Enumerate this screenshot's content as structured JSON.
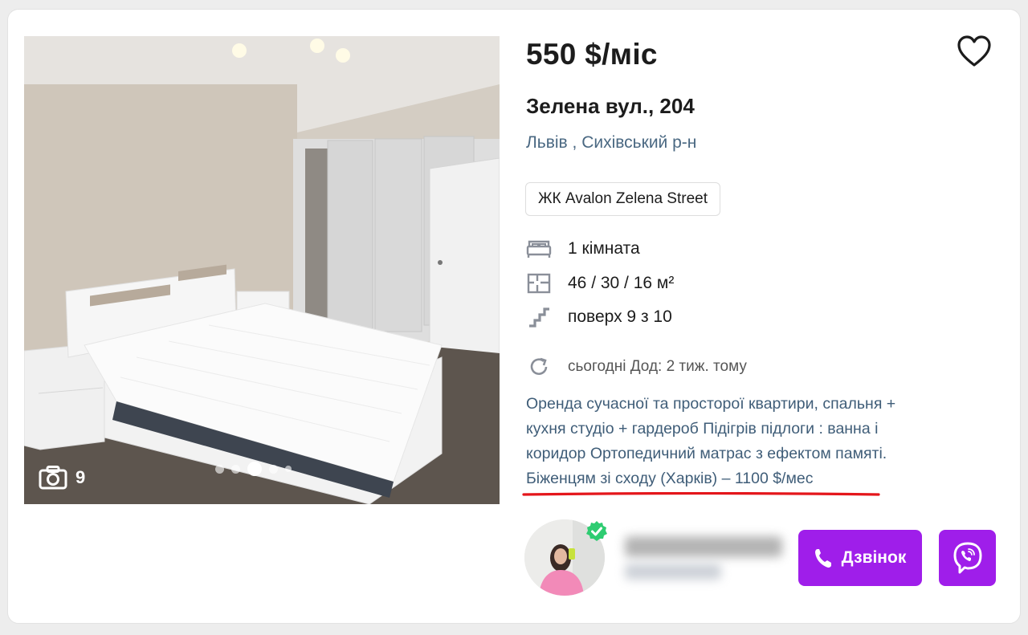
{
  "listing": {
    "price": "550 $/міс",
    "street": "Зелена вул., 204",
    "city_district": "Львів , Сихівський р-н",
    "complex": "ЖК Avalon Zelena Street",
    "features": {
      "rooms": "1 кімната",
      "area": "46 / 30 / 16 м²",
      "floor": "поверх 9 з 10"
    },
    "updated": "сьогодні  Дод: 2 тиж. тому",
    "description_lines": [
      "Оренда сучасної та просторої квартири, спальня +",
      "кухня студіо + гардероб Підігрів підлоги : ванна і",
      "коридор Ортопедичний матрас з ефектом памяті.",
      "Біженцям зі сходу (Харків) – 1100 $/мес"
    ]
  },
  "photo": {
    "count": "9",
    "dots": 5,
    "active_dot": 3
  },
  "actions": {
    "call_label": "Дзвінок"
  },
  "icons": {
    "favorite": "heart-outline-icon",
    "rooms": "bed-icon",
    "area": "floor-plan-icon",
    "floor": "stairs-icon",
    "updated": "refresh-icon",
    "camera": "camera-icon",
    "call": "phone-icon",
    "viber": "viber-icon",
    "verified": "verified-check-icon"
  },
  "colors": {
    "accent": "#9f1eea",
    "text_secondary": "#4a6882",
    "highlight_underline": "#e4161b",
    "verified": "#2ecc71"
  }
}
